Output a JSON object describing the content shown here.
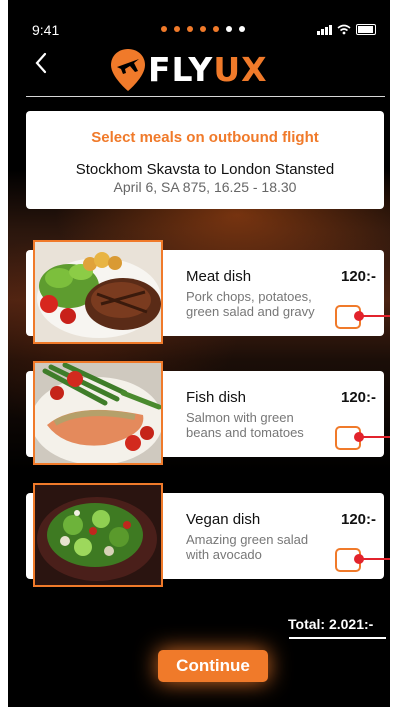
{
  "status_bar": {
    "time": "9:41",
    "page_dots": 7,
    "active_dot_count": 5
  },
  "header": {
    "brand": {
      "fly": "FLY",
      "ux": "UX"
    }
  },
  "flight": {
    "title": "Select meals on outbound flight",
    "route": "Stockhom Skavsta to London Stansted",
    "info": "April 6, SA 875, 16.25 - 18.30"
  },
  "meals": [
    {
      "name": "Meat dish",
      "description": "Pork chops, potatoes, green salad and gravy",
      "price": "120:-",
      "image": "meat-dish-photo"
    },
    {
      "name": "Fish dish",
      "description": "Salmon with green beans and tomatoes",
      "price": "120:-",
      "image": "fish-dish-photo"
    },
    {
      "name": "Vegan dish",
      "description": "Amazing green salad with avocado",
      "price": "120:-",
      "image": "vegan-dish-photo"
    }
  ],
  "total": "Total: 2.021:-",
  "continue_label": "Continue",
  "colors": {
    "accent": "#f07a2a",
    "background": "#000000",
    "pin": "#e2232c"
  }
}
